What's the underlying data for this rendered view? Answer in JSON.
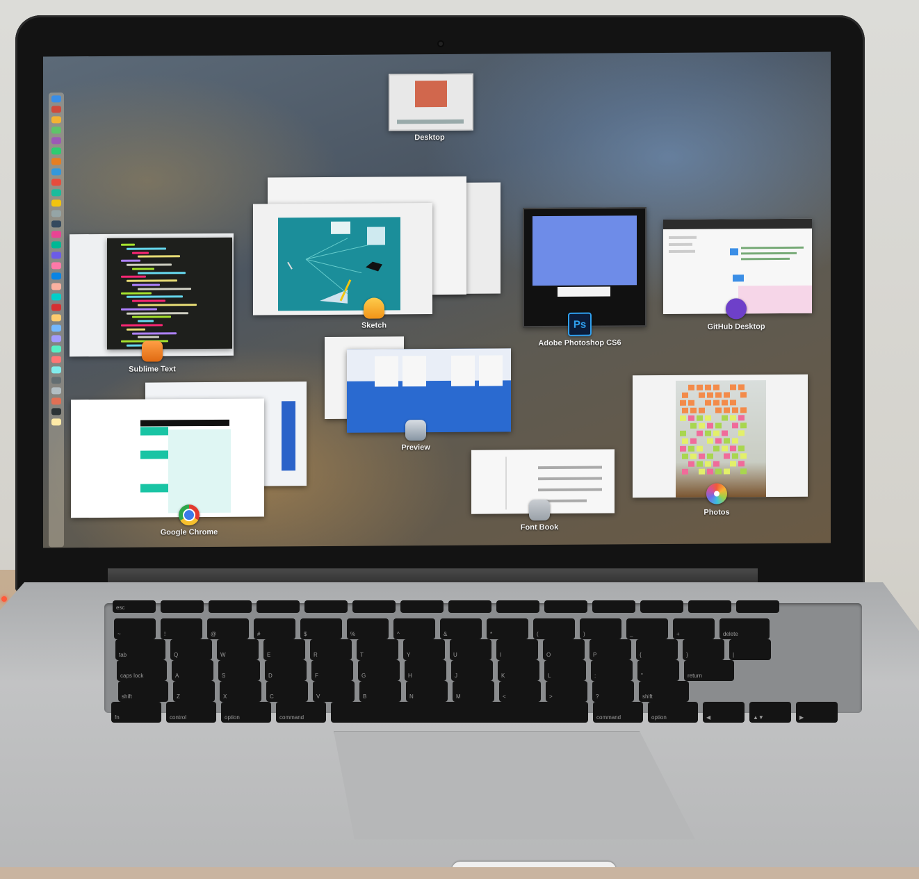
{
  "screen": {
    "mode": "Mission Control",
    "windows": [
      {
        "id": "desktop",
        "label": "Desktop"
      },
      {
        "id": "sublime",
        "label": "Sublime Text",
        "icon": "sublime-text-icon"
      },
      {
        "id": "sketch",
        "label": "Sketch",
        "icon": "sketch-icon"
      },
      {
        "id": "photoshop",
        "label": "Adobe Photoshop CS6",
        "icon": "photoshop-icon",
        "icon_text": "Ps"
      },
      {
        "id": "github",
        "label": "GitHub Desktop",
        "icon": "github-desktop-icon"
      },
      {
        "id": "preview",
        "label": "Preview",
        "icon": "preview-icon"
      },
      {
        "id": "chrome",
        "label": "Google Chrome",
        "icon": "chrome-icon"
      },
      {
        "id": "fontbook",
        "label": "Font Book",
        "icon": "font-book-icon"
      },
      {
        "id": "photos",
        "label": "Photos",
        "icon": "photos-icon"
      }
    ]
  },
  "dock": {
    "position": "left",
    "icon_colors": [
      "#3a8ee6",
      "#cf4b3c",
      "#f2b233",
      "#5fc36a",
      "#9b59b6",
      "#2ecc71",
      "#e67e22",
      "#3498db",
      "#e74c3c",
      "#1abc9c",
      "#f1c40f",
      "#95a5a6",
      "#34495e",
      "#e84393",
      "#00b894",
      "#6c5ce7",
      "#fd79a8",
      "#0984e3",
      "#fab1a0",
      "#00cec9",
      "#d63031",
      "#fdcb6e",
      "#74b9ff",
      "#a29bfe",
      "#55efc4",
      "#ff7675",
      "#81ecec",
      "#636e72",
      "#b2bec3",
      "#e17055",
      "#2d3436",
      "#ffeaa7"
    ]
  },
  "keyboard": {
    "rows": [
      [
        "esc",
        "",
        "",
        "",
        "",
        "",
        "",
        "",
        "",
        "",
        "",
        "",
        "",
        ""
      ],
      [
        "~",
        "!",
        "@",
        "#",
        "$",
        "%",
        "^",
        "&",
        "*",
        "(",
        ")",
        "_",
        "+",
        "delete"
      ],
      [
        "tab",
        "Q",
        "W",
        "E",
        "R",
        "T",
        "Y",
        "U",
        "I",
        "O",
        "P",
        "{",
        "}",
        "|"
      ],
      [
        "caps lock",
        "A",
        "S",
        "D",
        "F",
        "G",
        "H",
        "J",
        "K",
        "L",
        ":",
        "\"",
        "return"
      ],
      [
        "shift",
        "Z",
        "X",
        "C",
        "V",
        "B",
        "N",
        "M",
        "<",
        ">",
        "?",
        "shift"
      ],
      [
        "fn",
        "control",
        "option",
        "command",
        "",
        "command",
        "option",
        "◀",
        "▲▼",
        "▶"
      ]
    ]
  },
  "colors": {
    "sketch_canvas": "#1b8e9a",
    "photoshop_canvas": "#6e8ce8",
    "preview_doc": "#2a6ad0",
    "chrome_accent": "#19c4a4",
    "github_pink": "#f6d6e8"
  }
}
